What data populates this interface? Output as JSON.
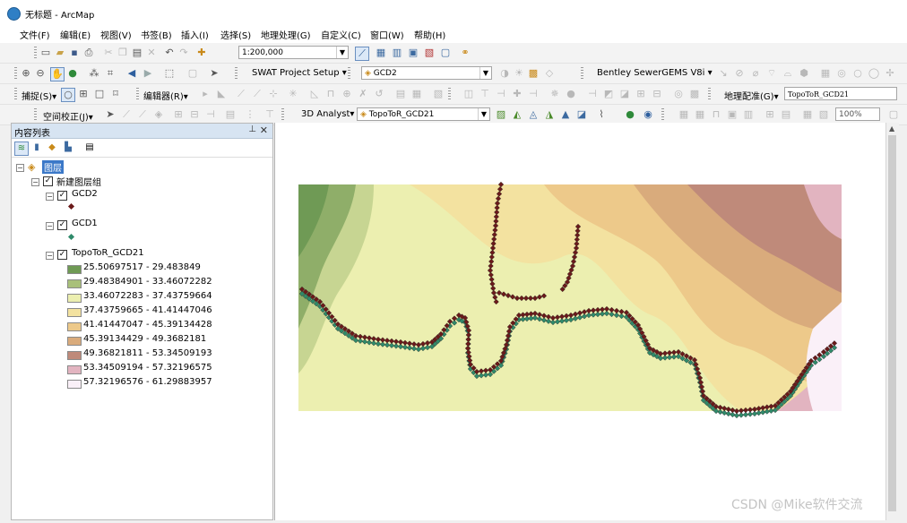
{
  "window": {
    "title": "无标题 - ArcMap"
  },
  "menu": [
    "文件(F)",
    "编辑(E)",
    "视图(V)",
    "书签(B)",
    "插入(I)",
    "选择(S)",
    "地理处理(G)",
    "自定义(C)",
    "窗口(W)",
    "帮助(H)"
  ],
  "toolbar1": {
    "scale": "1:200,000"
  },
  "toolbar2": {
    "swat": "SWAT Project Setup",
    "layer_combo": "GCD2",
    "bentley": "Bentley SewerGEMS V8i"
  },
  "toolbar3": {
    "capture": "捕捉(S)",
    "editor": "编辑器(R)",
    "georef": "地理配准(G)",
    "georef_layer": "TopoToR_GCD21"
  },
  "toolbar4": {
    "spatial_adjust": "空间校正(J)",
    "analyst3d": "3D Analyst",
    "analyst_layer": "TopoToR_GCD21",
    "zoom": "100%"
  },
  "toc": {
    "title": "内容列表",
    "root": "图层",
    "group": "新建图层组",
    "layers": [
      {
        "name": "GCD2",
        "symbol_color": "#6b1a1a"
      },
      {
        "name": "GCD1",
        "symbol_color": "#2f8a6a"
      },
      {
        "name": "TopoToR_GCD21"
      }
    ],
    "classes": [
      {
        "range": "25.50697517 - 29.483849",
        "color": "#6f9a55"
      },
      {
        "range": "29.48384901 - 33.46072282",
        "color": "#a9c07a"
      },
      {
        "range": "33.46072283 - 37.43759664",
        "color": "#ecefb0"
      },
      {
        "range": "37.43759665 - 41.41447046",
        "color": "#f3e2a0"
      },
      {
        "range": "41.41447047 - 45.39134428",
        "color": "#edc98a"
      },
      {
        "range": "45.39134429 - 49.3682181",
        "color": "#d9ab7c"
      },
      {
        "range": "49.36821811 - 53.34509193",
        "color": "#bf8a7a"
      },
      {
        "range": "53.34509194 - 57.32196575",
        "color": "#e2b4c0"
      },
      {
        "range": "57.32196576 - 61.29883957",
        "color": "#faf0f8"
      }
    ]
  },
  "watermark": "CSDN @Mike软件交流"
}
